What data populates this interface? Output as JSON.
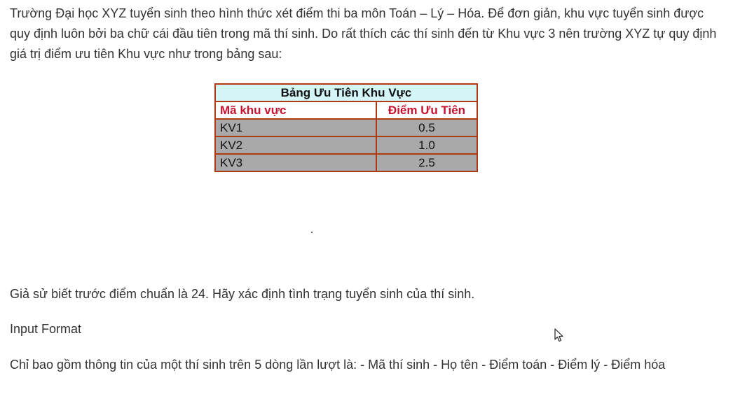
{
  "intro_paragraph": "Trường Đại học XYZ tuyển sinh theo hình thức xét điểm thi ba môn Toán – Lý – Hóa. Để đơn giản, khu vực tuyển sinh được quy định luôn bởi ba chữ cái đầu tiên trong mã thí sinh. Do rất thích các thí sinh đến từ Khu vực 3 nên trường XYZ tự quy định giá trị điểm ưu tiên Khu vực như trong bảng sau:",
  "priority_table": {
    "title": "Bảng Ưu Tiên Khu Vực",
    "headers": [
      "Mã khu vực",
      "Điểm Ưu Tiên"
    ],
    "rows": [
      [
        "KV1",
        "0.5"
      ],
      [
        "KV2",
        "1.0"
      ],
      [
        "KV3",
        "2.5"
      ]
    ],
    "colors": {
      "border": "#b23a12",
      "title_bg": "#d4f6f8",
      "header_text": "#c8102e",
      "row_bg": "#a9a9a9"
    }
  },
  "cutoff_paragraph": "Giả sử biết trước điểm chuẩn là 24. Hãy xác định tình trạng tuyển sinh của thí sinh.",
  "input_format_heading": "Input Format",
  "input_format_paragraph": "Chỉ bao gồm thông tin của một thí sinh trên 5 dòng lần lượt là: - Mã thí sinh - Họ tên - Điểm toán - Điểm lý - Điểm hóa",
  "cursor_icon": "mouse-pointer-icon"
}
